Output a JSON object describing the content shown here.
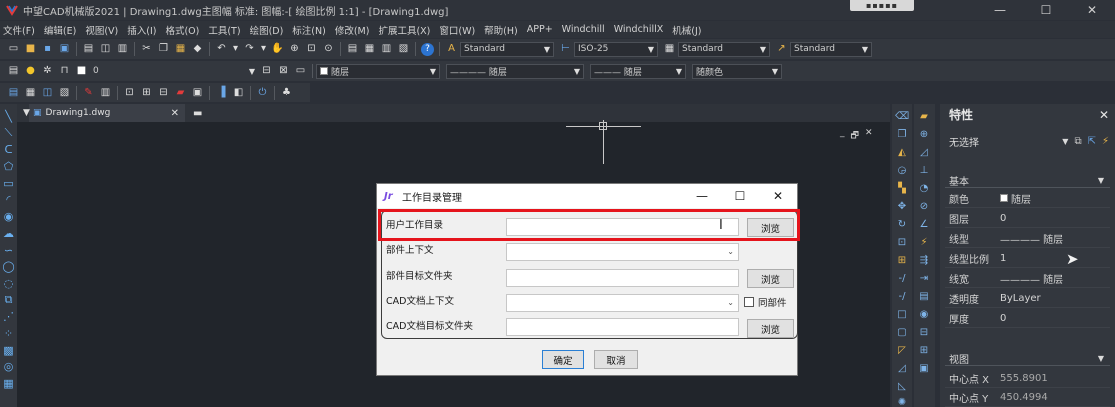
{
  "window": {
    "title": "中望CAD机械版2021 | Drawing1.dwg主图幅  标准: 图幅:-[ 绘图比例 1:1] - [Drawing1.dwg]",
    "controls": [
      "—",
      "☐",
      "✕"
    ]
  },
  "menu": [
    "文件(F)",
    "编辑(E)",
    "视图(V)",
    "插入(I)",
    "格式(O)",
    "工具(T)",
    "绘图(D)",
    "标注(N)",
    "修改(M)",
    "扩展工具(X)",
    "窗口(W)",
    "帮助(H)",
    "APP+",
    "Windchill",
    "WindchillX",
    "机械(J)"
  ],
  "toolbar": {
    "text_style": "Standard",
    "dim_style": "ISO-25",
    "table_style": "Standard",
    "multileader_style": "Standard",
    "layer": "0",
    "color": "随层",
    "linetype": "———— 随层",
    "lineweight": "——— 随层",
    "plotstyle": "随颜色"
  },
  "drawing_tab": {
    "label": "Drawing1.dwg",
    "close": "✕"
  },
  "canvas_controls": [
    "_",
    "🗗",
    "✕"
  ],
  "properties": {
    "title": "特性",
    "close": "✕",
    "selection": "无选择",
    "section_basic": "基本",
    "rows": [
      {
        "key": "颜色",
        "value": "随层"
      },
      {
        "key": "图层",
        "value": "0"
      },
      {
        "key": "线型",
        "value": "———— 随层"
      },
      {
        "key": "线型比例",
        "value": "1"
      },
      {
        "key": "线宽",
        "value": "———— 随层"
      },
      {
        "key": "透明度",
        "value": "ByLayer"
      },
      {
        "key": "厚度",
        "value": "0"
      }
    ],
    "section_view": "视图",
    "view_rows": [
      {
        "key": "中心点 X",
        "value": "555.8901"
      },
      {
        "key": "中心点 Y",
        "value": "450.4994"
      }
    ]
  },
  "dialog": {
    "title": "工作目录管理",
    "icon": "Jr",
    "controls": [
      "—",
      "☐",
      "✕"
    ],
    "fields": [
      {
        "label": "用户工作目录",
        "button": "浏览"
      },
      {
        "label": "部件上下文"
      },
      {
        "label": "部件目标文件夹",
        "button": "浏览"
      },
      {
        "label": "CAD文档上下文",
        "checkbox": "同部件"
      },
      {
        "label": "CAD文档目标文件夹",
        "button": "浏览"
      }
    ],
    "ok": "确定",
    "cancel": "取消"
  }
}
